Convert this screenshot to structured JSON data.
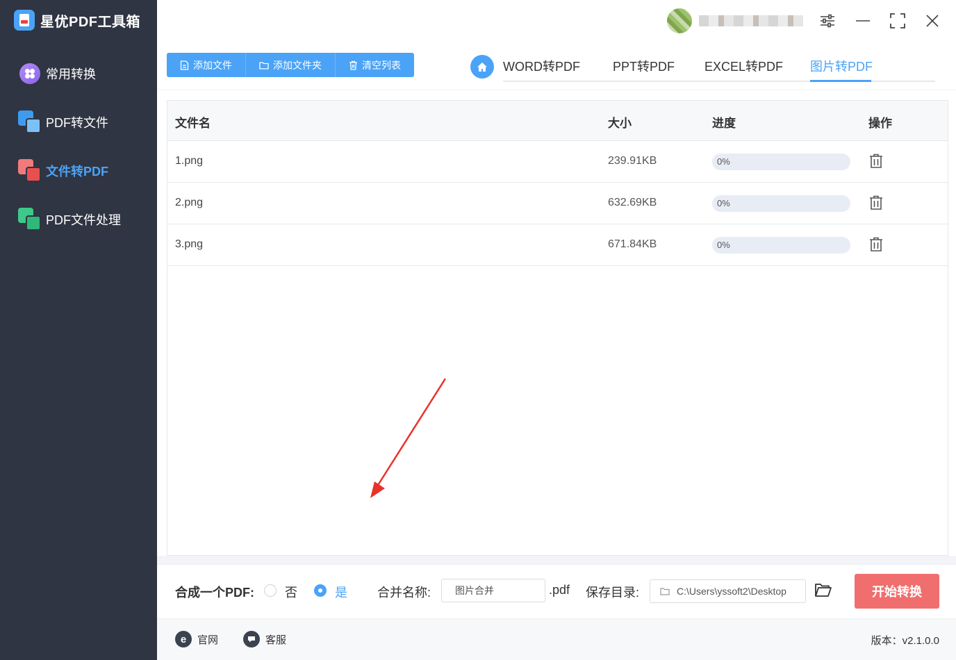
{
  "app": {
    "name": "星优PDF工具箱",
    "accent": "#4aa3f7",
    "sidebar_bg": "#2f3542",
    "start_color": "#f16e6e"
  },
  "sidebar": {
    "items": [
      {
        "label": "常用转换",
        "icon": "grid-circle-icon",
        "active": false
      },
      {
        "label": "PDF转文件",
        "icon": "pdf-to-file-icon",
        "active": false
      },
      {
        "label": "文件转PDF",
        "icon": "file-to-pdf-icon",
        "active": true
      },
      {
        "label": "PDF文件处理",
        "icon": "pdf-process-icon",
        "active": false
      }
    ]
  },
  "toolbar": {
    "add_file": "添加文件",
    "add_folder": "添加文件夹",
    "clear_list": "清空列表"
  },
  "tabs": [
    {
      "label": "WORD转PDF",
      "active": false
    },
    {
      "label": "PPT转PDF",
      "active": false
    },
    {
      "label": "EXCEL转PDF",
      "active": false
    },
    {
      "label": "图片转PDF",
      "active": true
    }
  ],
  "table": {
    "headers": {
      "name": "文件名",
      "size": "大小",
      "progress": "进度",
      "action": "操作"
    },
    "rows": [
      {
        "name": "1.png",
        "size": "239.91KB",
        "progress_text": "0%",
        "progress": 0
      },
      {
        "name": "2.png",
        "size": "632.69KB",
        "progress_text": "0%",
        "progress": 0
      },
      {
        "name": "3.png",
        "size": "671.84KB",
        "progress_text": "0%",
        "progress": 0
      }
    ]
  },
  "options": {
    "merge_label": "合成一个PDF:",
    "no_label": "否",
    "yes_label": "是",
    "merge_selected": "是",
    "merge_name_label": "合并名称:",
    "merge_name_value": "图片合并",
    "ext": ".pdf",
    "save_dir_label": "保存目录:",
    "save_dir_value": "C:\\Users\\yssoft2\\Desktop",
    "start_label": "开始转换"
  },
  "footer": {
    "website": "官网",
    "support": "客服",
    "version": "版本：v2.1.0.0"
  }
}
